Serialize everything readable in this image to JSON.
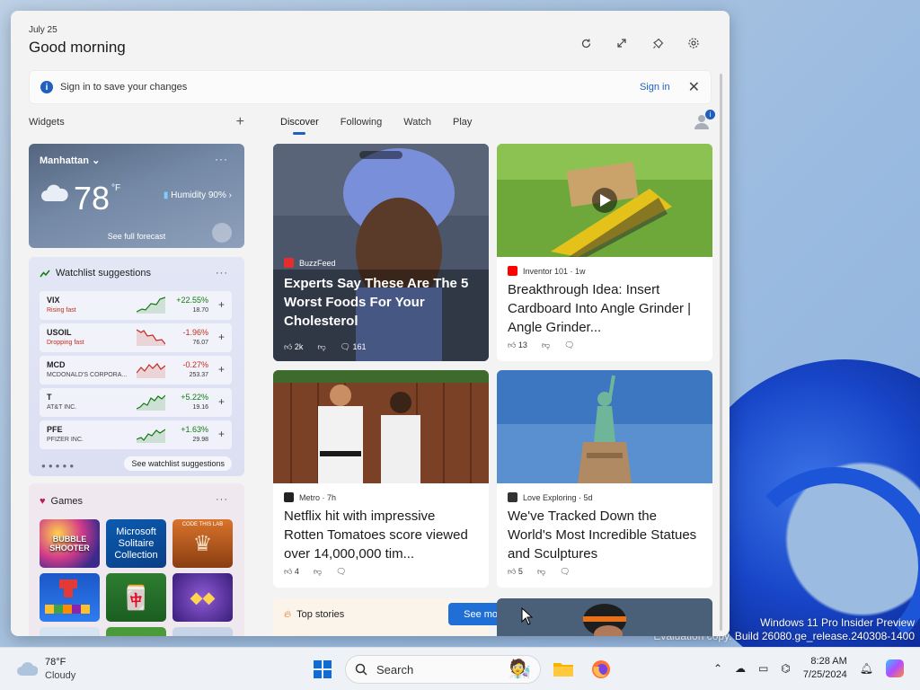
{
  "header": {
    "date": "July 25",
    "greeting": "Good morning"
  },
  "signin_bar": {
    "message": "Sign in to save your changes",
    "link": "Sign in"
  },
  "widgets": {
    "title": "Widgets",
    "weather": {
      "city": "Manhattan",
      "temp": "78",
      "unit": "°F",
      "humidity": "Humidity 90%",
      "forecast_link": "See full forecast"
    },
    "watchlist": {
      "title": "Watchlist suggestions",
      "link": "See watchlist suggestions",
      "stocks": [
        {
          "symbol": "VIX",
          "sub": "Rising fast",
          "pct": "+22.55%",
          "price": "18.70",
          "trend": "up"
        },
        {
          "symbol": "USOIL",
          "sub": "Dropping fast",
          "pct": "-1.96%",
          "price": "76.07",
          "trend": "down"
        },
        {
          "symbol": "MCD",
          "sub": "MCDONALD'S CORPORA...",
          "pct": "-0.27%",
          "price": "253.37",
          "trend": "down"
        },
        {
          "symbol": "T",
          "sub": "AT&T INC.",
          "pct": "+5.22%",
          "price": "19.16",
          "trend": "up"
        },
        {
          "symbol": "PFE",
          "sub": "PFIZER INC.",
          "pct": "+1.63%",
          "price": "29.98",
          "trend": "up"
        }
      ]
    },
    "games": {
      "title": "Games",
      "tiles": [
        "BUBBLE SHOOTER",
        "Microsoft Solitaire Collection",
        "CODE THIS LAB"
      ]
    }
  },
  "feed": {
    "tabs": [
      "Discover",
      "Following",
      "Watch",
      "Play"
    ],
    "active_tab": "Discover",
    "cards": [
      {
        "source": "BuzzFeed",
        "headline": "Experts Say These Are The 5 Worst Foods For Your Cholesterol",
        "likes": "2k",
        "comments": "161"
      },
      {
        "source": "Inventor 101 · 1w",
        "headline": "Breakthrough Idea: Insert Cardboard Into Angle Grinder | Angle Grinder...",
        "likes": "13",
        "comments": ""
      },
      {
        "source": "Metro · 7h",
        "headline": "Netflix hit with impressive Rotten Tomatoes score viewed over 14,000,000 tim...",
        "likes": "4",
        "comments": ""
      },
      {
        "source": "Love Exploring · 5d",
        "headline": "We've Tracked Down the World's Most Incredible Statues and Sculptures",
        "likes": "5",
        "comments": ""
      }
    ],
    "top_stories": "Top stories",
    "see_more": "See more"
  },
  "watermark": {
    "line1": "Windows 11 Pro Insider Preview",
    "line2": "Evaluation copy. Build 26080.ge_release.240308-1400"
  },
  "taskbar": {
    "weather_temp": "78°F",
    "weather_desc": "Cloudy",
    "search_placeholder": "Search",
    "time": "8:28 AM",
    "date": "7/25/2024"
  },
  "colors": {
    "accent": "#1f6fd6",
    "positive": "#0f7b0f",
    "negative": "#c42b1c"
  }
}
